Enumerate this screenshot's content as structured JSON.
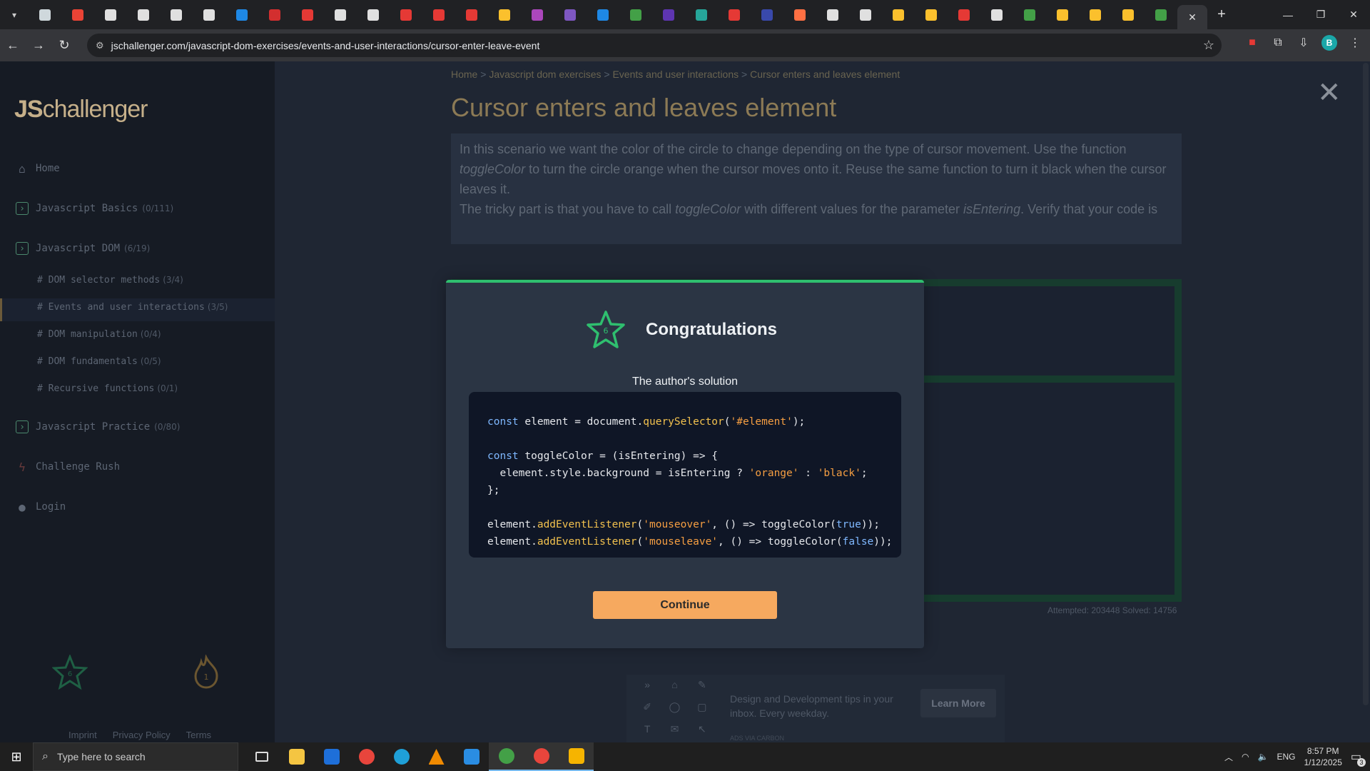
{
  "browser": {
    "url": "jschallenger.com/javascript-dom-exercises/events-and-user-interactions/cursor-enter-leave-event",
    "tab_colors": [
      "#cfd8dc",
      "#ea4335",
      "#e0e0e0",
      "#e0e0e0",
      "#e0e0e0",
      "#e0e0e0",
      "#1e88e5",
      "#d32f2f",
      "#e53935",
      "#e0e0e0",
      "#e0e0e0",
      "#e53935",
      "#e53935",
      "#e53935",
      "#fbc02d",
      "#ab47bc",
      "#7e57c2",
      "#1e88e5",
      "#43a047",
      "#5e35b1",
      "#26a69a",
      "#e53935",
      "#3949ab",
      "#ff7043",
      "#e0e0e0",
      "#e0e0e0",
      "#fbc02d",
      "#fbc02d",
      "#e53935",
      "#e0e0e0",
      "#43a047",
      "#fbc02d",
      "#fbc02d",
      "#fbc02d",
      "#43a047"
    ],
    "profile_initial": "B"
  },
  "sidebar": {
    "logo_prefix": "JS",
    "logo_suffix": "challenger",
    "items": [
      {
        "label": "Home",
        "count": ""
      },
      {
        "label": "Javascript Basics",
        "count": "(0/111)"
      },
      {
        "label": "Javascript DOM",
        "count": "(6/19)"
      },
      {
        "label": "Javascript Practice",
        "count": "(0/80)"
      },
      {
        "label": "Challenge Rush",
        "count": ""
      },
      {
        "label": "Login",
        "count": ""
      }
    ],
    "sub_items": [
      {
        "label": "# DOM selector methods",
        "count": "(3/4)"
      },
      {
        "label": "# Events and user interactions",
        "count": "(3/5)"
      },
      {
        "label": "# DOM manipulation",
        "count": "(0/4)"
      },
      {
        "label": "# DOM fundamentals",
        "count": "(0/5)"
      },
      {
        "label": "# Recursive functions",
        "count": "(0/1)"
      }
    ],
    "star_count": "6",
    "streak_count": "1",
    "footer": [
      "Imprint",
      "Privacy Policy",
      "Terms"
    ]
  },
  "main": {
    "breadcrumb": [
      "Home",
      "Javascript dom exercises",
      "Events and user interactions",
      "Cursor enters and leaves element"
    ],
    "title": "Cursor enters and leaves element",
    "description": {
      "p1a": "In this scenario we want the color of the circle to change depending on the type of cursor movement. Use the function ",
      "p1b": "toggleColor",
      "p1c": " to turn the circle orange when the cursor moves onto it. Reuse the same function to turn it black when the cursor leaves it.",
      "p2a": "The tricky part is that you have to call ",
      "p2b": "toggleColor",
      "p2c": " with different values for the parameter ",
      "p2d": "isEntering",
      "p2e": ". Verify that your code is"
    },
    "stats": "Attempted: 203448   Solved: 14756"
  },
  "ad": {
    "text": "Design and Development tips in your inbox. Every weekday.",
    "button": "Learn More",
    "via": "ADS VIA CARBON"
  },
  "modal": {
    "title": "Congratulations",
    "star_count": "6",
    "author_label": "The author's solution",
    "continue_label": "Continue",
    "code": {
      "l1_kw": "const",
      "l1_rest": " element = document.",
      "l1_fn": "querySelector",
      "l1_p1": "(",
      "l1_str": "'#element'",
      "l1_end": ");",
      "l3_kw": "const",
      "l3_rest": " toggleColor = (isEntering) => {",
      "l4_rest": "  element.style.background = isEntering ? ",
      "l4_s1": "'orange'",
      "l4_mid": " : ",
      "l4_s2": "'black'",
      "l4_end": ";",
      "l5": "};",
      "l7_a": "element.",
      "l7_fn": "addEventListener",
      "l7_p": "(",
      "l7_str": "'mouseover'",
      "l7_mid": ", () => toggleColor(",
      "l7_bool": "true",
      "l7_end": "));",
      "l8_a": "element.",
      "l8_fn": "addEventListener",
      "l8_p": "(",
      "l8_str": "'mouseleave'",
      "l8_mid": ", () => toggleColor(",
      "l8_bool": "false",
      "l8_end": "));"
    }
  },
  "taskbar": {
    "search_placeholder": "Type here to search",
    "language": "ENG",
    "time": "8:57 PM",
    "date": "1/12/2025",
    "notifications": "3"
  }
}
